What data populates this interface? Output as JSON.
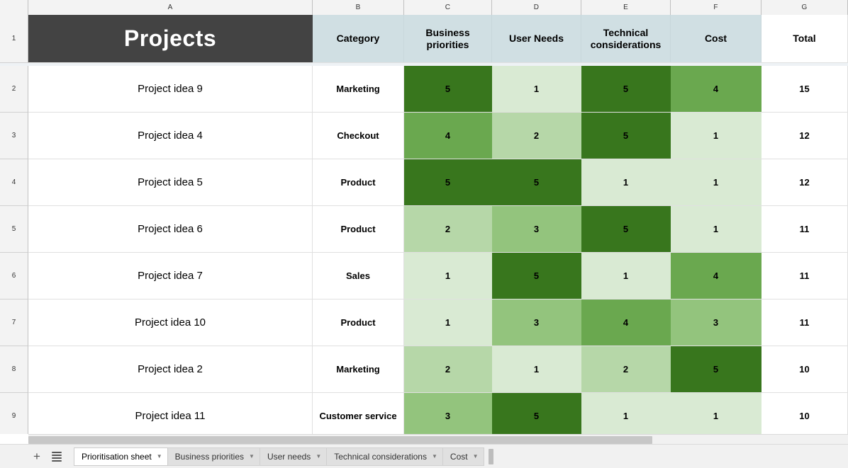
{
  "grid": {
    "column_letters": [
      "A",
      "B",
      "C",
      "D",
      "E",
      "F",
      "G"
    ],
    "row_numbers": [
      "1",
      "2",
      "3",
      "4",
      "5",
      "6",
      "7",
      "8",
      "9"
    ]
  },
  "table": {
    "title": "Projects",
    "headers": [
      "Category",
      "Business priorities",
      "User Needs",
      "Technical considerations",
      "Cost",
      "Total"
    ],
    "rows": [
      {
        "project": "Project idea 9",
        "category": "Marketing",
        "business": 5,
        "user": 1,
        "technical": 5,
        "cost": 4,
        "total": 15
      },
      {
        "project": "Project idea 4",
        "category": "Checkout",
        "business": 4,
        "user": 2,
        "technical": 5,
        "cost": 1,
        "total": 12
      },
      {
        "project": "Project idea 5",
        "category": "Product",
        "business": 5,
        "user": 5,
        "technical": 1,
        "cost": 1,
        "total": 12
      },
      {
        "project": "Project idea 6",
        "category": "Product",
        "business": 2,
        "user": 3,
        "technical": 5,
        "cost": 1,
        "total": 11
      },
      {
        "project": "Project idea 7",
        "category": "Sales",
        "business": 1,
        "user": 5,
        "technical": 1,
        "cost": 4,
        "total": 11
      },
      {
        "project": "Project idea 10",
        "category": "Product",
        "business": 1,
        "user": 3,
        "technical": 4,
        "cost": 3,
        "total": 11
      },
      {
        "project": "Project idea 2",
        "category": "Marketing",
        "business": 2,
        "user": 1,
        "technical": 2,
        "cost": 5,
        "total": 10
      },
      {
        "project": "Project idea 11",
        "category": "Customer service",
        "business": 3,
        "user": 5,
        "technical": 1,
        "cost": 1,
        "total": 10
      }
    ]
  },
  "colors": {
    "title_bg": "#434343",
    "header_bg": "#d0dfe3",
    "scale_1": "#d9ead3",
    "scale_2": "#b6d7a8",
    "scale_3": "#93c47d",
    "scale_4": "#6aa84f",
    "scale_5": "#38761d"
  },
  "bottom_bar": {
    "add_sheet_icon": "plus-icon",
    "all_sheets_icon": "hamburger-icon",
    "tabs": [
      {
        "label": "Prioritisation sheet",
        "active": true
      },
      {
        "label": "Business priorities",
        "active": false
      },
      {
        "label": "User needs",
        "active": false
      },
      {
        "label": "Technical considerations",
        "active": false
      },
      {
        "label": "Cost",
        "active": false
      }
    ],
    "caret": "▼"
  }
}
